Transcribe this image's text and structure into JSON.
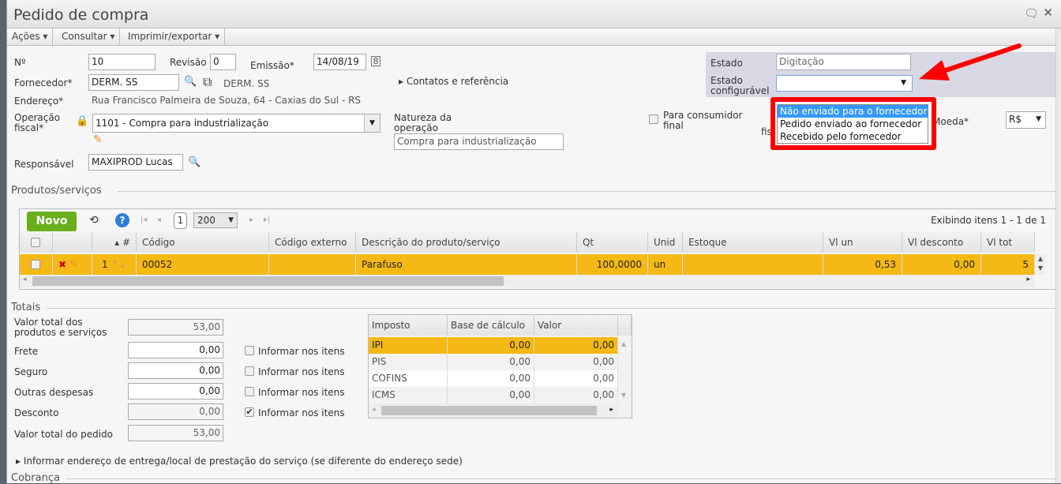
{
  "window": {
    "title": "Pedido de compra",
    "icons": [
      "comment-icon",
      "close-icon"
    ]
  },
  "menu": [
    {
      "label": "Ações"
    },
    {
      "label": "Consultar"
    },
    {
      "label": "Imprimir/exportar"
    }
  ],
  "form": {
    "numero_label": "Nº",
    "numero": "10",
    "revisao_label": "Revisão",
    "revisao": "0",
    "emissao_label": "Emissão*",
    "emissao": "14/08/19",
    "fornecedor_label": "Fornecedor*",
    "fornecedor": "DERM. SS",
    "fornecedor_nome": "DERM. SS",
    "endereco_label": "Endereço*",
    "endereco": "Rua Francisco Palmeira de Souza, 64 - Caxias do Sul - RS",
    "operacao_label_1": "Operação",
    "operacao_label_2": "fiscal*",
    "operacao": "1101 - Compra para industrialização",
    "responsavel_label": "Responsável",
    "responsavel": "MAXIPROD Lucas",
    "contatos": "Contatos e referência",
    "natureza_label_1": "Natureza da",
    "natureza_label_2": "operação",
    "natureza": "Compra para industrialização",
    "consumidor_label_1": "Para consumidor",
    "consumidor_label_2": "final",
    "consumidor_checked": false,
    "fis_partial": "fis",
    "moeda_label": "Moeda*",
    "moeda": "R$",
    "estado_label": "Estado",
    "estado": "Digitação",
    "estado_conf_label_1": "Estado",
    "estado_conf_label_2": "configurável",
    "estado_conf": "",
    "estado_conf_options": [
      "Não enviado para o fornecedor",
      "Pedido enviado ao fornecedor",
      "Recebido pelo fornecedor"
    ],
    "estado_conf_highlighted": "Não enviado para o fornecedor"
  },
  "products": {
    "section": "Produtos/serviços",
    "new_button": "Novo",
    "page": "1",
    "page_size": "200",
    "showing": "Exibindo itens 1 - 1 de 1",
    "columns": [
      "#",
      "Código",
      "Código externo",
      "Descrição do produto/serviço",
      "Qt",
      "Unid",
      "Estoque",
      "Vl un",
      "Vl desconto",
      "Vl tot"
    ],
    "rows": [
      {
        "n": "1",
        "codigo": "00052",
        "externo": "",
        "descricao": "Parafuso",
        "qt": "100,0000",
        "unid": "un",
        "estoque": "",
        "vl_un": "0,53",
        "vl_desc": "0,00",
        "vl_tot": "5"
      }
    ]
  },
  "totais": {
    "section": "Totais",
    "valor_prod_label_1": "Valor total dos",
    "valor_prod_label_2": "produtos e serviços",
    "valor_prod": "53,00",
    "frete_label": "Frete",
    "frete": "0,00",
    "seguro_label": "Seguro",
    "seguro": "0,00",
    "outras_label": "Outras despesas",
    "outras": "0,00",
    "desconto_label": "Desconto",
    "desconto": "0,00",
    "total_label": "Valor total do pedido",
    "total": "53,00",
    "informar": "Informar nos itens",
    "informar_checked": [
      false,
      false,
      false,
      true
    ]
  },
  "impostos": {
    "columns": [
      "Imposto",
      "Base de cálculo",
      "Valor"
    ],
    "rows": [
      {
        "nome": "IPI",
        "base": "0,00",
        "valor": "0,00"
      },
      {
        "nome": "PIS",
        "base": "0,00",
        "valor": "0,00"
      },
      {
        "nome": "COFINS",
        "base": "0,00",
        "valor": "0,00"
      },
      {
        "nome": "ICMS",
        "base": "0,00",
        "valor": "0,00"
      }
    ]
  },
  "entrega_link": "Informar endereço de entrega/local de prestação do serviço (se diferente do endereço sede)",
  "cobranca_section": "Cobrança",
  "colors": {
    "highlight_row": "#f5b915",
    "new_button": "#6aae1b",
    "annotation": "#ff0000",
    "selected_option": "#3399ff"
  }
}
